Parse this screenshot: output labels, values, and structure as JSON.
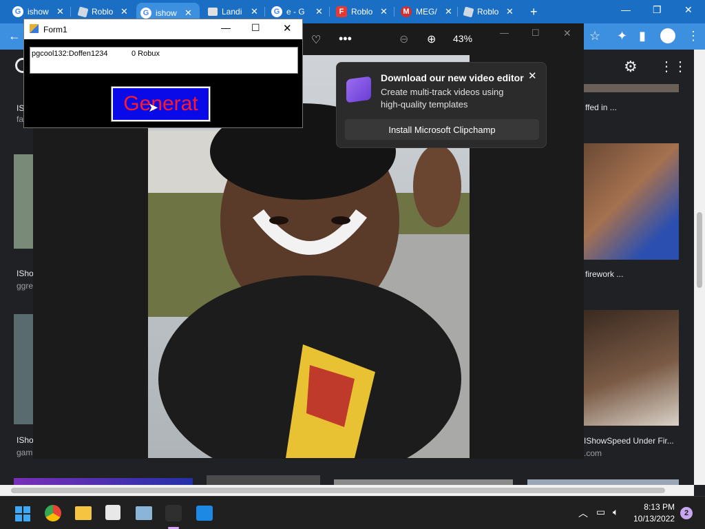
{
  "browser": {
    "tabs": [
      {
        "title": "ishow",
        "favicon": "google-icon",
        "color": "#ffffff"
      },
      {
        "title": "Roblo",
        "favicon": "roblox-icon",
        "color": "#cfd8e3"
      },
      {
        "title": "ishow",
        "favicon": "google-icon",
        "color": "#ffffff"
      },
      {
        "title": "Landi",
        "favicon": "landing-icon",
        "color": "#e0e0e0"
      },
      {
        "title": "e - G",
        "favicon": "google-icon",
        "color": "#ffffff"
      },
      {
        "title": "Roblo",
        "favicon": "roblox-red-icon",
        "color": "#e53935"
      },
      {
        "title": "MEG/",
        "favicon": "mega-icon",
        "color": "#d32f2f"
      },
      {
        "title": "Roblo",
        "favicon": "roblox-icon",
        "color": "#cfd8e3"
      }
    ],
    "new_tab": "+"
  },
  "viewer": {
    "zoom": "43%"
  },
  "popup": {
    "title": "Download our new video editor",
    "body": "Create multi-track videos using high-quality templates",
    "button": "Install Microsoft Clipchamp"
  },
  "form1": {
    "title": "Form1",
    "account": "pgcool132:Doffen1234",
    "robux": "0 Robux",
    "button": "Generat"
  },
  "results": {
    "left": [
      {
        "title": "IS",
        "source": "fa"
      },
      {
        "title": "ISho",
        "source": "ggre"
      },
      {
        "title": "ISho",
        "source": "gam"
      }
    ],
    "right": [
      {
        "title": "ffed in ...",
        "source": ""
      },
      {
        "title": "firework ...",
        "source": ""
      },
      {
        "title": "IShowSpeed Under Fir...",
        "source": ".com"
      }
    ]
  },
  "taskbar": {
    "time": "8:13 PM",
    "date": "10/13/2022",
    "notifications": "2"
  }
}
